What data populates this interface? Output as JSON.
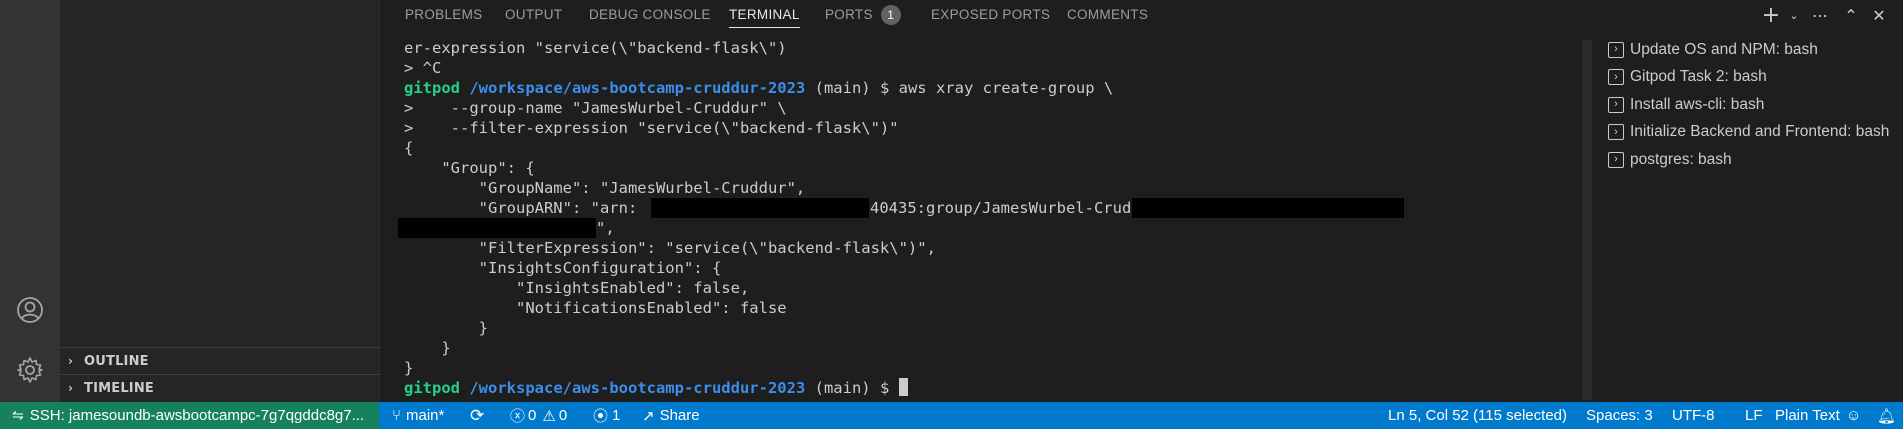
{
  "panel": {
    "tabs": [
      {
        "label": "PROBLEMS"
      },
      {
        "label": "OUTPUT"
      },
      {
        "label": "DEBUG CONSOLE"
      },
      {
        "label": "TERMINAL"
      },
      {
        "label": "PORTS",
        "badge": "1"
      },
      {
        "label": "EXPOSED PORTS"
      },
      {
        "label": "COMMENTS"
      }
    ]
  },
  "sidebar": {
    "outline": "OUTLINE",
    "timeline": "TIMELINE"
  },
  "terminal": {
    "lines": [
      "er-expression \"service(\\\"backend-flask\\\")",
      "> ^C",
      "",
      ">    --group-name \"JamesWurbel-Cruddur\" \\",
      ">    --filter-expression \"service(\\\"backend-flask\\\")\"",
      "{",
      "    \"Group\": {",
      "        \"GroupName\": \"JamesWurbel-Cruddur\",",
      "        \"GroupARN\": \"arn:",
      "",
      "        \"FilterExpression\": \"service(\\\"backend-flask\\\")\",",
      "        \"InsightsConfiguration\": {",
      "            \"InsightsEnabled\": false,",
      "            \"NotificationsEnabled\": false",
      "        }",
      "    }",
      "}"
    ],
    "prompt_user": "gitpod",
    "prompt_path": "/workspace/aws-bootcamp-cruddur-2023",
    "prompt_branch": " (main) $ ",
    "command": "aws xray create-group \\",
    "arn_suffix": "40435:group/JamesWurbel-Cruddur/",
    "arn_end": "\","
  },
  "terminal_list": [
    "Update OS and NPM: bash",
    "Gitpod Task 2: bash",
    "Install aws-cli: bash",
    "Initialize Backend and Frontend: bash",
    "postgres: bash"
  ],
  "status": {
    "remote": "SSH: jamesoundb-awsbootcampc-7g7qgddc8g7...",
    "branch": "main*",
    "errors": "0",
    "warnings": "0",
    "ports": "1",
    "share": "Share",
    "position": "Ln 5, Col 52 (115 selected)",
    "spaces": "Spaces: 3",
    "encoding": "UTF-8",
    "eol": "LF",
    "language": "Plain Text"
  }
}
